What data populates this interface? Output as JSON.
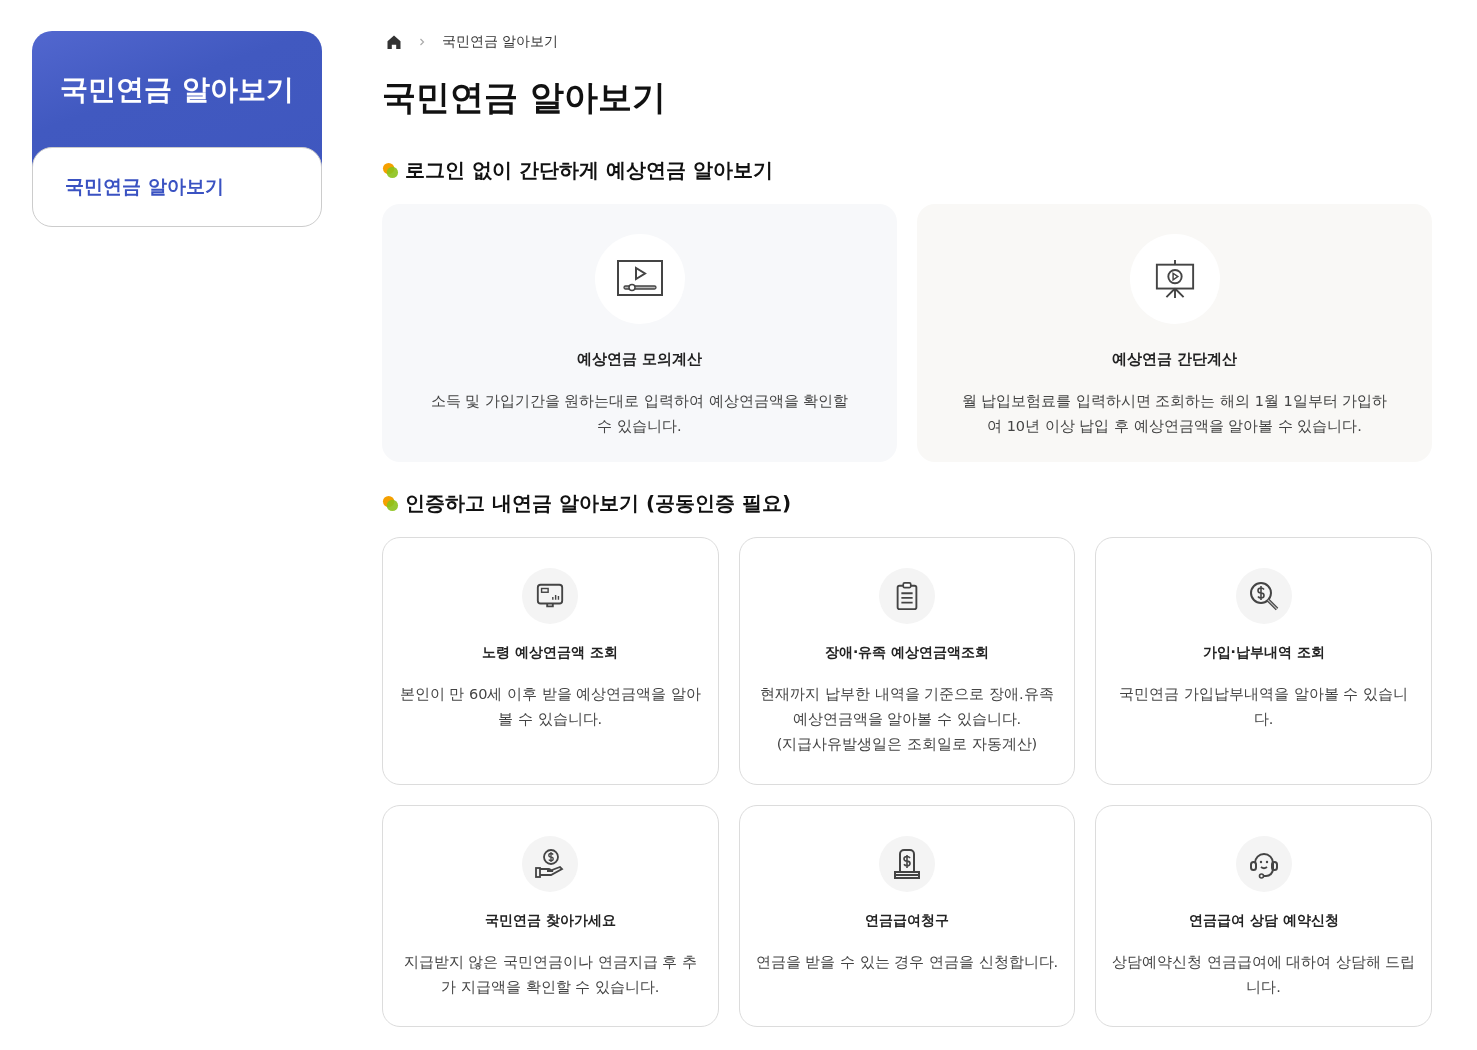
{
  "sidebar": {
    "title": "국민연금 알아보기",
    "items": [
      {
        "label": "국민연금 알아보기",
        "selected": true
      }
    ]
  },
  "breadcrumb": [
    "국민연금 알아보기"
  ],
  "page_title": "국민연금 알아보기",
  "sections": [
    {
      "heading": "로그인 없이 간단하게 예상연금 알아보기",
      "cards": [
        {
          "title": "예상연금 모의계산",
          "description": "소득 및 가입기간을 원하는대로 입력하여 예상연금액을 확인할 수 있습니다."
        },
        {
          "title": "예상연금 간단계산",
          "description": "월 납입보험료를 입력하시면 조회하는 해의 1월 1일부터 가입하여 10년 이상 납입 후 예상연금액을 알아볼 수 있습니다."
        }
      ]
    },
    {
      "heading": "인증하고 내연금 알아보기 (공동인증 필요)",
      "cards": [
        {
          "title": "노령 예상연금액 조회",
          "description": "본인이 만 60세 이후 받을 예상연금액을 알아볼 수 있습니다."
        },
        {
          "title": "장애·유족 예상연금액조회",
          "description": "현재까지 납부한 내역을 기준으로 장애.유족 예상연금액을 알아볼 수 있습니다.",
          "note": "(지급사유발생일은 조회일로 자동계산)"
        },
        {
          "title": "가입·납부내역 조회",
          "description": "국민연금 가입납부내역을 알아볼 수 있습니다."
        },
        {
          "title": "국민연금 찾아가세요",
          "description": "지급받지 않은 국민연금이나 연금지급 후 추가 지급액을 확인할 수 있습니다."
        },
        {
          "title": "연금급여청구",
          "description": "연금을 받을 수 있는 경우 연금을 신청합니다."
        },
        {
          "title": "연금급여 상담 예약신청",
          "description": "상담예약신청 연금급여에 대하여 상담해 드립니다."
        }
      ]
    }
  ]
}
